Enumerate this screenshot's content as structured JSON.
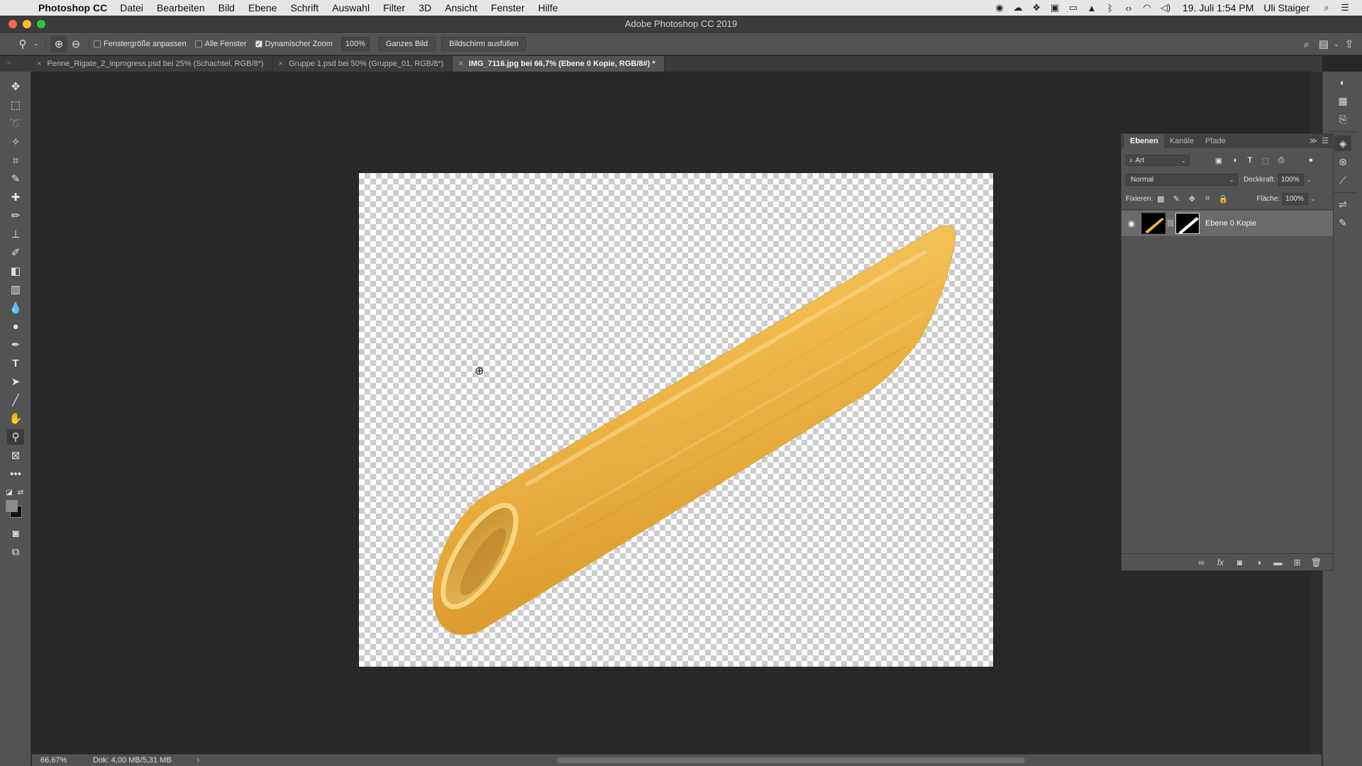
{
  "menubar": {
    "app_name": "Photoshop CC",
    "items": [
      "Datei",
      "Bearbeiten",
      "Bild",
      "Ebene",
      "Schrift",
      "Auswahl",
      "Filter",
      "3D",
      "Ansicht",
      "Fenster",
      "Hilfe"
    ],
    "datetime": "19. Juli 1:54 PM",
    "user": "Uli Staiger"
  },
  "window": {
    "title": "Adobe Photoshop CC 2019"
  },
  "options": {
    "fit_window_label": "Fenstergröße anpassen",
    "all_windows_label": "Alle Fenster",
    "dynamic_zoom_label": "Dynamischer Zoom",
    "dynamic_zoom_checked": true,
    "zoom_value": "100%",
    "fit_screen_button": "Ganzes Bild",
    "fill_screen_button": "Bildschirm ausfüllen"
  },
  "tabs": [
    {
      "label": "Penne_Rigate_2_inprogress.psd bei 25% (Schachtel, RGB/8*)",
      "active": false
    },
    {
      "label": "Gruppe 1.psd bei 50% (Gruppe_01, RGB/8*)",
      "active": false
    },
    {
      "label": "IMG_7116.jpg bei 66,7% (Ebene 0 Kopie, RGB/8#) *",
      "active": true
    }
  ],
  "status": {
    "zoom": "66,67%",
    "doc_size": "Dok: 4,00 MB/5,31 MB"
  },
  "layers_panel": {
    "tabs": [
      "Ebenen",
      "Kanäle",
      "Pfade"
    ],
    "active_tab": "Ebenen",
    "filter_kind": "Art",
    "blend_mode": "Normal",
    "opacity_label": "Deckkraft:",
    "opacity_value": "100%",
    "lock_label": "Fixieren:",
    "fill_label": "Fläche:",
    "fill_value": "100%",
    "layers": [
      {
        "name": "Ebene 0 Kopie",
        "visible": true,
        "selected": true
      }
    ]
  },
  "colors": {
    "pasta_light": "#f6cf6a",
    "pasta_mid": "#eeb444",
    "pasta_dark": "#d99a2c",
    "ui_panel": "#535353",
    "workspace": "#282828"
  }
}
